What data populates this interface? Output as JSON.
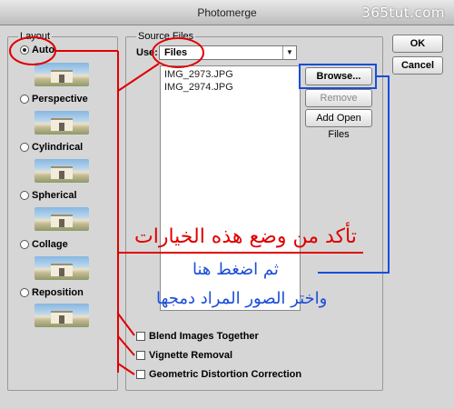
{
  "window": {
    "title": "Photomerge",
    "watermark": "365tut.com"
  },
  "layout": {
    "legend": "Layout",
    "options": [
      {
        "label": "Auto",
        "selected": true
      },
      {
        "label": "Perspective",
        "selected": false
      },
      {
        "label": "Cylindrical",
        "selected": false
      },
      {
        "label": "Spherical",
        "selected": false
      },
      {
        "label": "Collage",
        "selected": false
      },
      {
        "label": "Reposition",
        "selected": false
      }
    ]
  },
  "source": {
    "legend": "Source Files",
    "use_label": "Use:",
    "use_value": "Files",
    "files": [
      "IMG_2973.JPG",
      "IMG_2974.JPG"
    ]
  },
  "buttons": {
    "ok": "OK",
    "cancel": "Cancel",
    "browse": "Browse...",
    "remove": "Remove",
    "add_open": "Add Open Files"
  },
  "checkboxes": [
    {
      "label": "Blend Images Together",
      "checked": false
    },
    {
      "label": "Vignette Removal",
      "checked": false
    },
    {
      "label": "Geometric Distortion Correction",
      "checked": false
    }
  ],
  "annotations": {
    "line1": "تأكد من وضع هذه الخيارات",
    "line2": "ثم اضغط هنا",
    "line3": "واختر الصور المراد دمجها"
  },
  "colors": {
    "annotation_red": "#e00000",
    "annotation_blue": "#1a4dd8"
  }
}
